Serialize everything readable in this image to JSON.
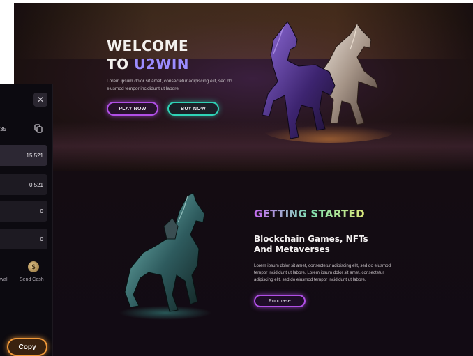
{
  "hero": {
    "title_line1": "WELCOME",
    "title_line2_prefix": "TO ",
    "title_line2_accent": "U2WIN",
    "text": "Lorem ipsum dolor sit amet, consectetur adipiscing elit, sed do eiusmod tempor incididunt ut labore",
    "play_label": "PLAY NOW",
    "buy_label": "BUY NOW"
  },
  "getting_started": {
    "title": "GETTING STARTED",
    "subtitle": "Blockchain Games, NFTs And Metaverses",
    "text": "Lorem ipsum dolor sit amet, consectetur adipiscing elit, sed do eiusmod tempor incididunt ut labore. Lorem ipsum dolor sit amet, consectetur adipiscing elit, sed do eiusmod tempor incididunt ut labore.",
    "purchase_label": "Purchase"
  },
  "wallet": {
    "close_symbol": "✕",
    "code_fragment": "35",
    "balances": [
      "15.521",
      "0.521",
      "0",
      "0"
    ],
    "withdrawal_fragment": "wal",
    "send_cash_label": "Send Cash",
    "send_icon_symbol": "$",
    "copy_label": "Copy"
  },
  "colors": {
    "accent_purple": "#b14fe6",
    "accent_teal": "#2fd3b6",
    "accent_orange": "#f29a3a",
    "title_accent": "#9b8cff"
  },
  "icons": [
    "close-icon",
    "copy-icon",
    "send-cash-icon",
    "horse-illustration-purple",
    "horse-illustration-teal"
  ]
}
